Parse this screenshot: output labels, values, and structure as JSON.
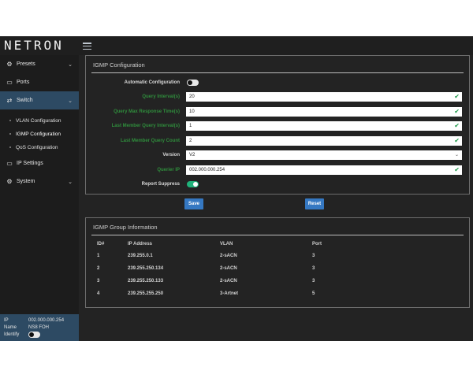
{
  "app": {
    "logo": "NETRON"
  },
  "sidebar": {
    "items": [
      {
        "label": "Presets",
        "icon": "gear-icon",
        "chevron": "⌄"
      },
      {
        "label": "Ports",
        "icon": "monitor-icon"
      },
      {
        "label": "Switch",
        "icon": "shuffle-icon",
        "chevron": "⌄",
        "active": true,
        "children": [
          "VLAN Configuration",
          "IGMP Configuration",
          "QoS Configuration"
        ]
      },
      {
        "label": "IP Settings",
        "icon": "monitor-icon"
      },
      {
        "label": "System",
        "icon": "gear-icon",
        "chevron": "⌄"
      }
    ],
    "footer": {
      "ip_key": "IP",
      "ip_value": "002.000.000.254",
      "name_key": "Name",
      "name_value": "NS8 FOH",
      "identify_key": "Identify",
      "identify_on": false
    }
  },
  "igmp": {
    "title": "IGMP Configuration",
    "fields": {
      "auto_config": {
        "label": "Automatic Configuration",
        "on": false
      },
      "query_interval": {
        "label": "Query Interval(s)",
        "value": "20"
      },
      "query_max_response": {
        "label": "Query Max Response Time(s)",
        "value": "10"
      },
      "last_member_interval": {
        "label": "Last Member Query Interval(s)",
        "value": "1"
      },
      "last_member_count": {
        "label": "Last Member Query Count",
        "value": "2"
      },
      "version": {
        "label": "Version",
        "value": "V2"
      },
      "querier_ip": {
        "label": "Querier IP",
        "value": "002.000.000.254"
      },
      "report_suppress": {
        "label": "Report Suppress",
        "on": true
      }
    },
    "save_label": "Save",
    "reset_label": "Reset"
  },
  "group": {
    "title": "IGMP Group Information",
    "columns": [
      "ID#",
      "IP Address",
      "VLAN",
      "Port"
    ],
    "rows": [
      [
        "1",
        "239.255.0.1",
        "2-sACN",
        "3"
      ],
      [
        "2",
        "239.255.250.134",
        "2-sACN",
        "3"
      ],
      [
        "3",
        "239.255.250.133",
        "2-sACN",
        "3"
      ],
      [
        "4",
        "239.255.255.250",
        "3-Artnet",
        "5"
      ]
    ]
  },
  "colors": {
    "accent": "#3578c2",
    "sidebar_active": "#2d4a63",
    "label_green": "#2f8d3c",
    "toggle_on": "#1fb27a"
  }
}
